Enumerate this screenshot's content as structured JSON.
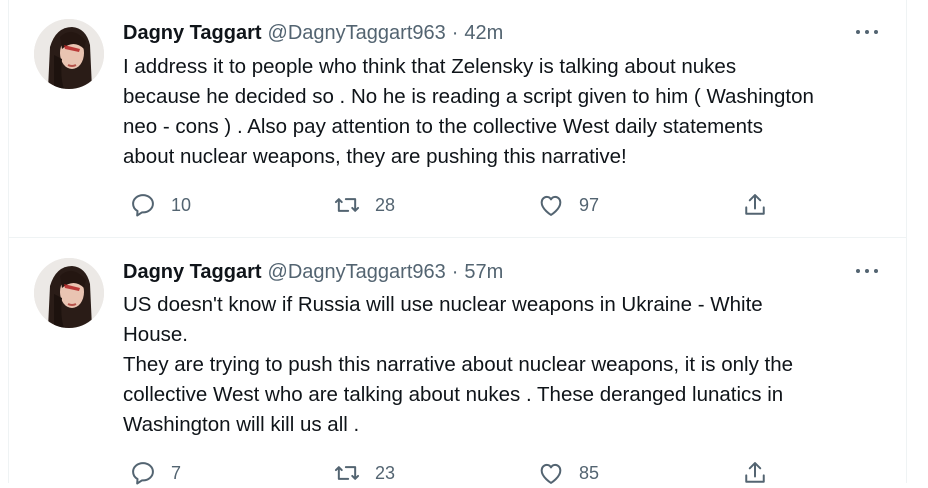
{
  "tweets": [
    {
      "name": "Dagny Taggart",
      "handle": "@DagnyTaggart963",
      "separator": "·",
      "time": "42m",
      "text_lines": [
        "I address it to people who think that Zelensky is talking about nukes",
        "because he decided so . No he is reading a script given to him ( Washington",
        "neo - cons ) . Also pay attention to the collective West daily statements",
        "about nuclear weapons, they are pushing this narrative!"
      ],
      "replies": "10",
      "retweets": "28",
      "likes": "97",
      "icons": {
        "reply": "reply-icon",
        "retweet": "retweet-icon",
        "like": "heart-icon",
        "share": "share-icon",
        "more": "more-icon"
      }
    },
    {
      "name": "Dagny Taggart",
      "handle": "@DagnyTaggart963",
      "separator": "·",
      "time": "57m",
      "text_lines": [
        "US doesn't know if Russia will use nuclear weapons in Ukraine - White",
        "House.",
        "They are trying to push this narrative about nuclear weapons, it is only the",
        "collective West who are talking about nukes . These deranged lunatics in",
        "Washington will kill us all ."
      ],
      "replies": "7",
      "retweets": "23",
      "likes": "85",
      "icons": {
        "reply": "reply-icon",
        "retweet": "retweet-icon",
        "like": "heart-icon",
        "share": "share-icon",
        "more": "more-icon"
      }
    }
  ],
  "colors": {
    "text": "#0f1419",
    "secondary": "#536471",
    "divider": "#eff3f4"
  }
}
